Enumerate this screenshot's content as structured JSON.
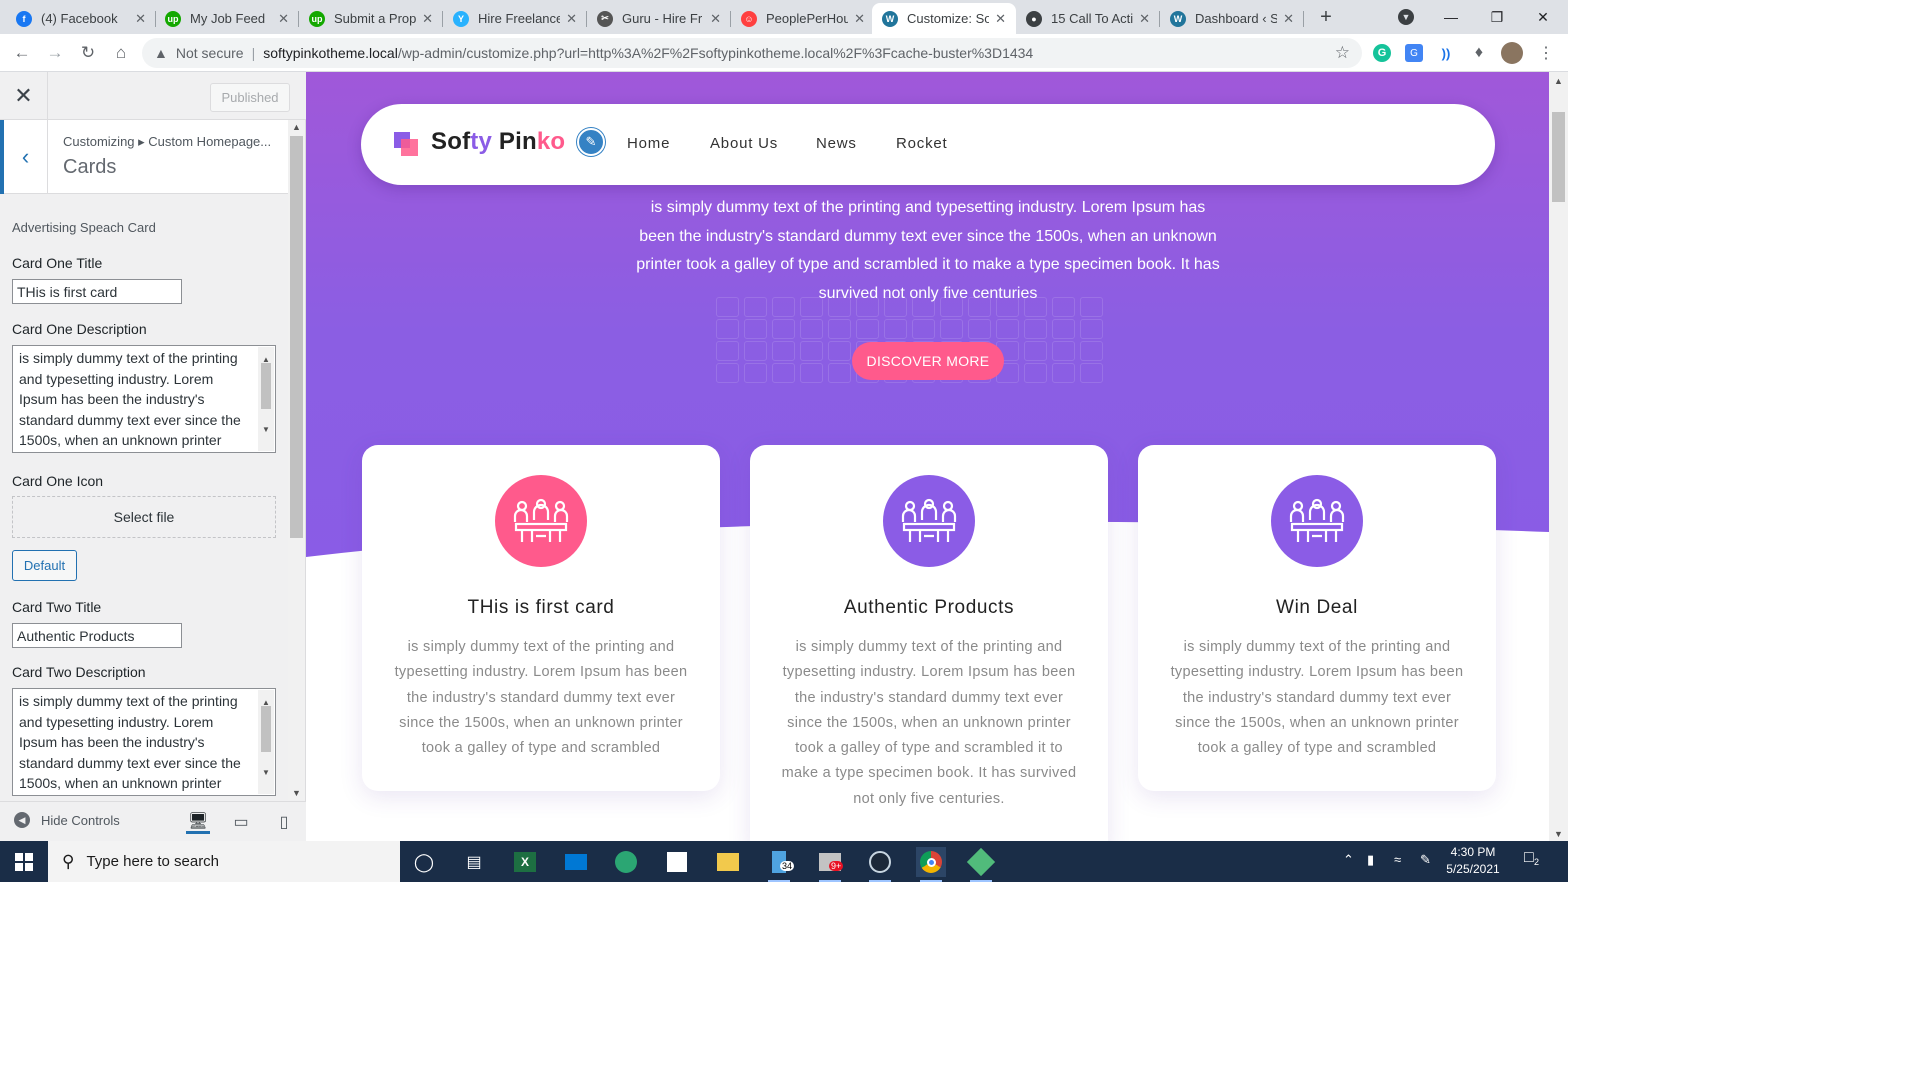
{
  "browser": {
    "tabs": [
      {
        "title": "(4) Facebook",
        "favicon": "facebook-icon",
        "color": "#1877f2",
        "glyph": "f"
      },
      {
        "title": "My Job Feed",
        "favicon": "upwork-icon",
        "color": "#14a800",
        "glyph": "up"
      },
      {
        "title": "Submit a Prop",
        "favicon": "upwork-icon",
        "color": "#14a800",
        "glyph": "up"
      },
      {
        "title": "Hire Freelance",
        "favicon": "freelancer-icon",
        "color": "#29b2fe",
        "glyph": "Y"
      },
      {
        "title": "Guru - Hire Fr",
        "favicon": "guru-icon",
        "color": "#555555",
        "glyph": "✂"
      },
      {
        "title": "PeoplePerHou",
        "favicon": "peopleperhour-icon",
        "color": "#ff4040",
        "glyph": "☺"
      },
      {
        "title": "Customize: So",
        "favicon": "wordpress-icon",
        "color": "#21759b",
        "glyph": "W"
      },
      {
        "title": "15 Call To Acti",
        "favicon": "generic-icon",
        "color": "#3c4043",
        "glyph": "●"
      },
      {
        "title": "Dashboard ‹ S",
        "favicon": "wordpress-icon",
        "color": "#21759b",
        "glyph": "W"
      }
    ],
    "new_tab": "+",
    "address": {
      "security": "Not secure",
      "host": "softypinkotheme.local",
      "path": "/wp-admin/customize.php?url=http%3A%2F%2Fsoftypinkotheme.local%2F%3Fcache-buster%3D1434"
    }
  },
  "customizer": {
    "published_label": "Published",
    "breadcrumb": "Customizing ▸ Custom Homepage...",
    "section_title": "Cards",
    "group_label": "Advertising Speach Card",
    "card_one_title_label": "Card One Title",
    "card_one_title_value": "THis is first card",
    "card_one_desc_label": "Card One Description",
    "card_one_desc_value": "is simply dummy text of the printing and typesetting industry. Lorem Ipsum has been the industry's standard dummy text ever since the 1500s, when an unknown printer",
    "card_one_icon_label": "Card One Icon",
    "select_file_label": "Select file",
    "default_label": "Default",
    "card_two_title_label": "Card Two Title",
    "card_two_title_value": "Authentic Products",
    "card_two_desc_label": "Card Two Description",
    "card_two_desc_value": "is simply dummy text of the printing and typesetting industry. Lorem Ipsum has been the industry's standard dummy text ever since the 1500s, when an unknown printer",
    "hide_controls_label": "Hide Controls"
  },
  "site": {
    "brand": {
      "part1": "Sof",
      "part2": "ty",
      "part3": " Pin",
      "part4": "ko"
    },
    "menu": [
      "Home",
      "About Us",
      "News",
      "Rocket"
    ],
    "hero_text": "is simply dummy text of the printing and typesetting industry. Lorem Ipsum has been the industry's standard dummy text ever since the 1500s, when an unknown printer took a galley of type and scrambled it to make a type specimen book. It has survived not only five centuries",
    "cta_label": "DISCOVER MORE",
    "cards": [
      {
        "title": "THis is first card",
        "icon_color": "#ff5a8c",
        "desc": "is simply dummy text of the printing and typesetting industry. Lorem Ipsum has been the industry's standard dummy text ever since the 1500s, when an unknown printer took a galley of type and scrambled"
      },
      {
        "title": "Authentic Products",
        "icon_color": "#8b5ce6",
        "desc": "is simply dummy text of the printing and typesetting industry. Lorem Ipsum has been the industry's standard dummy text ever since the 1500s, when an unknown printer took a galley of type and scrambled it to make a type specimen book. It has survived not only five centuries."
      },
      {
        "title": "Win Deal",
        "icon_color": "#8b5ce6",
        "desc": "is simply dummy text of the printing and typesetting industry. Lorem Ipsum has been the industry's standard dummy text ever since the 1500s, when an unknown printer took a galley of type and scrambled"
      }
    ],
    "colors": {
      "primary": "#8b5ce6",
      "accent": "#ff5a8c"
    }
  },
  "taskbar": {
    "search_placeholder": "Type here to search",
    "store_badge": "34",
    "tray_badge": "9+",
    "time": "4:30 PM",
    "date": "5/25/2021",
    "notif_count": "2"
  }
}
